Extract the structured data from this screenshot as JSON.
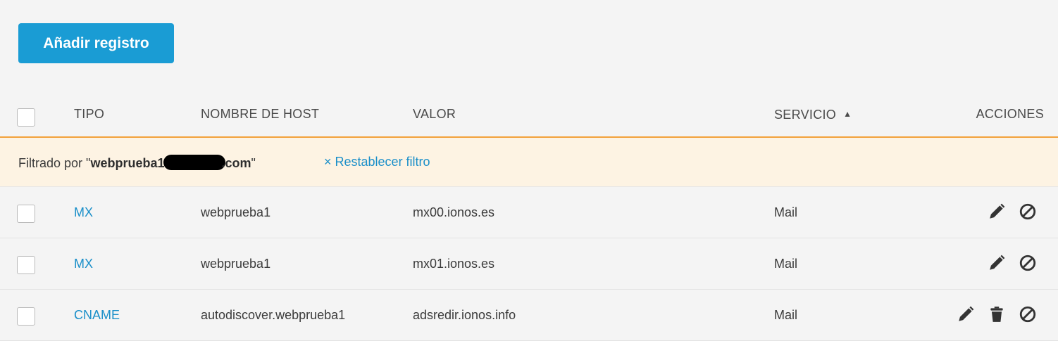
{
  "toolbar": {
    "add_label": "Añadir registro"
  },
  "table": {
    "headers": {
      "type": "TIPO",
      "host": "NOMBRE DE HOST",
      "value": "VALOR",
      "service": "SERVICIO",
      "service_sort": "▲",
      "actions": "ACCIONES"
    },
    "filter": {
      "prefix": "Filtrado por \"",
      "domain_start": "webprueba1.",
      "domain_end": ".com",
      "suffix": "\"",
      "reset_label": "× Restablecer filtro"
    },
    "rows": [
      {
        "type": "MX",
        "host": "webprueba1",
        "value": "mx00.ionos.es",
        "service": "Mail",
        "actions": [
          "edit-icon",
          "block-icon"
        ]
      },
      {
        "type": "MX",
        "host": "webprueba1",
        "value": "mx01.ionos.es",
        "service": "Mail",
        "actions": [
          "edit-icon",
          "block-icon"
        ]
      },
      {
        "type": "CNAME",
        "host": "autodiscover.webprueba1",
        "value": "adsredir.ionos.info",
        "service": "Mail",
        "actions": [
          "edit-icon",
          "trash-icon",
          "block-icon"
        ]
      }
    ]
  },
  "colors": {
    "primary": "#1a9cd4",
    "link": "#1a8fc9",
    "header_border": "#f2a13a",
    "filter_bg": "#fdf3e3",
    "background": "#f4f4f4"
  }
}
